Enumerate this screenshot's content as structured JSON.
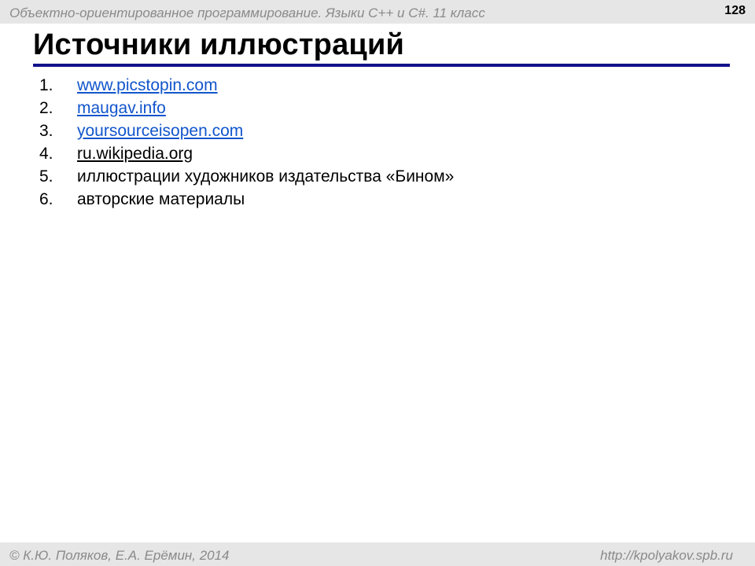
{
  "header": {
    "course_title": "Объектно-ориентированное программирование. Языки С++ и C#. 11 класс",
    "page_number": "128"
  },
  "slide": {
    "title": "Источники иллюстраций",
    "items": [
      {
        "num": "1.",
        "text": "www.picstopin.com"
      },
      {
        "num": "2.",
        "text": "maugav.info"
      },
      {
        "num": "3.",
        "text": "yoursourceisopen.com"
      },
      {
        "num": "4.",
        "text": "ru.wikipedia.org"
      },
      {
        "num": "5.",
        "text": "иллюстрации художников издательства «Бином»"
      },
      {
        "num": "6.",
        "text": "авторские материалы"
      }
    ]
  },
  "footer": {
    "copyright": "© К.Ю. Поляков, Е.А. Ерёмин, 2014",
    "url": "http://kpolyakov.spb.ru"
  },
  "colors": {
    "title_rule": "#12128a",
    "link": "#1155cc",
    "band": "#e6e6e6"
  }
}
